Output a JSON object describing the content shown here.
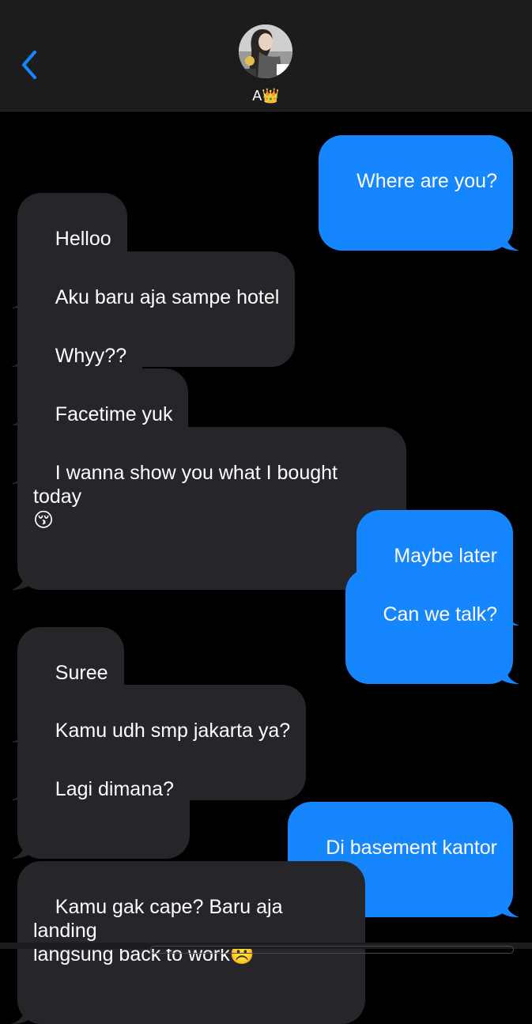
{
  "header": {
    "contact_name": "A👑",
    "back_icon": "chevron-left-icon",
    "accent_color": "#1686fe"
  },
  "messages": [
    {
      "direction": "outgoing",
      "text": "Where are you?"
    },
    {
      "direction": "incoming",
      "text": "Helloo"
    },
    {
      "direction": "incoming",
      "text": "Aku baru aja sampe hotel"
    },
    {
      "direction": "incoming",
      "text": "Whyy??"
    },
    {
      "direction": "incoming",
      "text": "Facetime yuk"
    },
    {
      "direction": "incoming",
      "text": "I wanna show you what I bought today\n😚"
    },
    {
      "direction": "outgoing",
      "text": "Maybe later"
    },
    {
      "direction": "outgoing",
      "text": "Can we talk?"
    },
    {
      "direction": "incoming",
      "text": "Suree"
    },
    {
      "direction": "incoming",
      "text": "Kamu udh smp jakarta ya?"
    },
    {
      "direction": "incoming",
      "text": "Lagi dimana?"
    },
    {
      "direction": "outgoing",
      "text": "Di basement kantor"
    },
    {
      "direction": "incoming",
      "text": "Kamu gak cape? Baru aja landing\nlangsung back to work☹️"
    }
  ],
  "colors": {
    "incoming_bubble": "#26252a",
    "outgoing_bubble": "#1686fe",
    "background": "#000000",
    "header_background": "#1c1c1e"
  }
}
